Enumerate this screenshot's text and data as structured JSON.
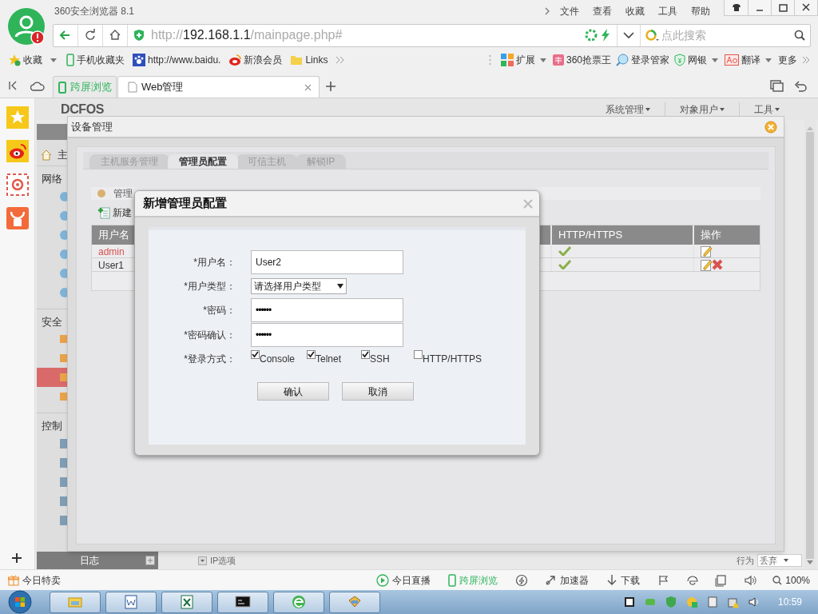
{
  "browser": {
    "title": "360安全浏览器 8.1",
    "menu": [
      "文件",
      "查看",
      "收藏",
      "工具",
      "帮助"
    ],
    "url": {
      "scheme": "http://",
      "host": "192.168.1.1",
      "path": "/mainpage.php#"
    },
    "search": {
      "placeholder": "点此搜索"
    },
    "bookmarks": [
      {
        "label": "收藏",
        "has_menu": true
      },
      {
        "label": "手机收藏夹",
        "has_menu": false
      },
      {
        "label": "http://www.baidu.",
        "has_menu": false
      },
      {
        "label": "新浪会员",
        "has_menu": false
      },
      {
        "label": "Links",
        "has_menu": false
      }
    ],
    "extensions": [
      {
        "label": "扩展",
        "has_menu": true
      },
      {
        "label": "360抢票王",
        "has_menu": false
      },
      {
        "label": "登录管家",
        "has_menu": false
      },
      {
        "label": "网银",
        "has_menu": true
      },
      {
        "label": "翻译",
        "has_menu": true
      },
      {
        "label": "更多",
        "has_menu": false
      }
    ],
    "tabs": [
      {
        "label": "跨屏浏览",
        "selected": false,
        "kind": "special"
      },
      {
        "label": "Web管理",
        "selected": true,
        "kind": "page"
      }
    ]
  },
  "app": {
    "logo": "DCFOS",
    "menus": [
      "系统管理",
      "对象用户",
      "工具"
    ],
    "home_label": "主",
    "sections": [
      "网络",
      "安全",
      "控制"
    ],
    "bottom": {
      "log": "日志",
      "ip_option": "IP选项",
      "action_label": "行为",
      "action_value": "丢弃"
    }
  },
  "device_dialog": {
    "title": "设备管理",
    "tabs": [
      {
        "label": "主机服务管理",
        "selected": false
      },
      {
        "label": "管理员配置",
        "selected": true
      },
      {
        "label": "可信主机",
        "selected": false
      },
      {
        "label": "解锁IP",
        "selected": false
      }
    ],
    "section_title": "管理",
    "new_button": "新建",
    "table": {
      "columns": [
        "用户名",
        "HTTP/HTTPS",
        "操作"
      ],
      "rows": [
        {
          "name": "admin",
          "kind": "system",
          "http": true,
          "deletable": false
        },
        {
          "name": "User1",
          "kind": "user",
          "http": true,
          "deletable": true
        }
      ]
    }
  },
  "add_dialog": {
    "title": "新增管理员配置",
    "fields": [
      {
        "label": "*用户名：",
        "kind": "text",
        "value": "User2"
      },
      {
        "label": "*用户类型：",
        "kind": "select",
        "value": "请选择用户类型"
      },
      {
        "label": "*密码：",
        "kind": "password",
        "value": "••••••"
      },
      {
        "label": "*密码确认：",
        "kind": "password",
        "value": "••••••"
      }
    ],
    "login": {
      "label": "*登录方式：",
      "options": [
        {
          "label": "Console",
          "checked": true
        },
        {
          "label": "Telnet",
          "checked": true
        },
        {
          "label": "SSH",
          "checked": true
        },
        {
          "label": "HTTP/HTTPS",
          "checked": false
        }
      ]
    },
    "buttons": [
      "确认",
      "取消"
    ]
  },
  "status_bar": {
    "promo": "今日特卖",
    "items": [
      {
        "label": "今日直播",
        "highlighted": false
      },
      {
        "label": "跨屏浏览",
        "highlighted": true
      },
      {
        "label": "加速器",
        "highlighted": false
      },
      {
        "label": "下载",
        "highlighted": false
      }
    ],
    "zoom": "100%"
  },
  "taskbar": {
    "clock": "10:59"
  }
}
